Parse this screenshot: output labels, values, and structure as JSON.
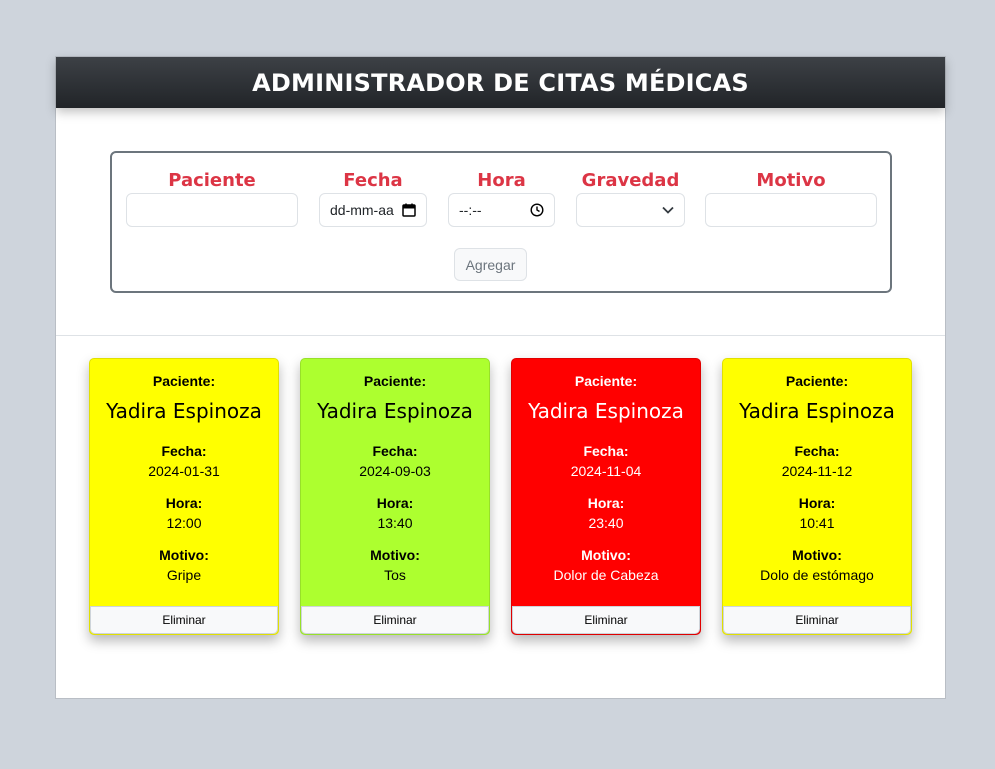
{
  "header": {
    "title": "ADMINISTRADOR DE CITAS MÉDICAS"
  },
  "form": {
    "paciente_label": "Paciente",
    "fecha_label": "Fecha",
    "fecha_placeholder": "dd-mm-aa",
    "hora_label": "Hora",
    "hora_placeholder": "--:--",
    "gravedad_label": "Gravedad",
    "motivo_label": "Motivo",
    "submit_label": "Agregar"
  },
  "cards": [
    {
      "paciente_label": "Paciente:",
      "paciente": "Yadira Espinoza",
      "fecha_label": "Fecha:",
      "fecha": "2024-01-31",
      "hora_label": "Hora:",
      "hora": "12:00",
      "motivo_label": "Motivo:",
      "motivo": "Gripe",
      "delete_label": "Eliminar",
      "color": "#ffff00"
    },
    {
      "paciente_label": "Paciente:",
      "paciente": "Yadira Espinoza",
      "fecha_label": "Fecha:",
      "fecha": "2024-09-03",
      "hora_label": "Hora:",
      "hora": "13:40",
      "motivo_label": "Motivo:",
      "motivo": "Tos",
      "delete_label": "Eliminar",
      "color": "#adff2f"
    },
    {
      "paciente_label": "Paciente:",
      "paciente": "Yadira Espinoza",
      "fecha_label": "Fecha:",
      "fecha": "2024-11-04",
      "hora_label": "Hora:",
      "hora": "23:40",
      "motivo_label": "Motivo:",
      "motivo": "Dolor de Cabeza",
      "delete_label": "Eliminar",
      "color": "#ff0000"
    },
    {
      "paciente_label": "Paciente:",
      "paciente": "Yadira Espinoza",
      "fecha_label": "Fecha:",
      "fecha": "2024-11-12",
      "hora_label": "Hora:",
      "hora": "10:41",
      "motivo_label": "Motivo:",
      "motivo": "Dolo de estómago",
      "delete_label": "Eliminar",
      "color": "#ffff00"
    }
  ]
}
